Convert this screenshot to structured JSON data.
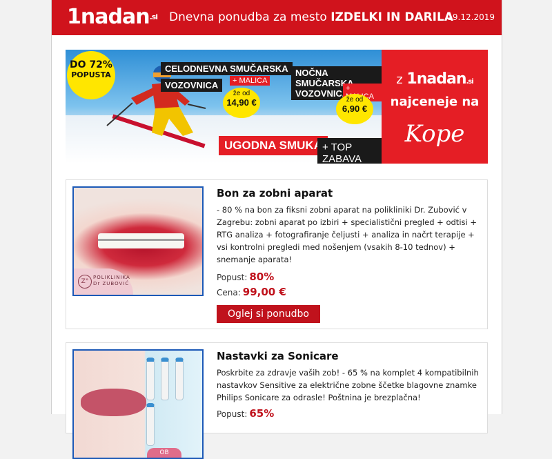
{
  "header": {
    "logo_text": "1nadan",
    "logo_suffix": ".si",
    "title_prefix": "Dnevna ponudba za mesto ",
    "title_city": "IZDELKI IN DARILA",
    "date": "19.12.2019",
    "colors": {
      "brand": "#d0131c"
    }
  },
  "banner": {
    "badge_line1": "DO 72%",
    "badge_line2": "POPUSTA",
    "tag1_line1": "CELODNEVNA SMUČARSKA",
    "tag1_line2": "VOZOVNICA",
    "tag1_extra": "+ MALICA",
    "tag1_price_from": "že od",
    "tag1_price": "14,90 €",
    "tag2_line1": "NOČNA SMUČARSKA",
    "tag2_line2": "VOZOVNICA",
    "tag2_extra": "+ MALICA",
    "tag2_price_from": "že od",
    "tag2_price": "6,90 €",
    "cta1": "UGODNA SMUKA",
    "cta2": "+ TOP ZABAVA",
    "right_z": "z",
    "right_logo": "1nadan",
    "right_logo_suffix": ".si",
    "right_text": "najceneje na",
    "right_brand": "Kope"
  },
  "offers": [
    {
      "title": "Bon za zobni aparat",
      "description": "- 80 % na bon za fiksni zobni aparat na polikliniki Dr. Zubović v Zagrebu: zobni aparat po izbiri + specialistični pregled + odtisi + RTG analiza + fotografiranje čeljusti + analiza in načrt terapije + vsi kontrolni pregledi med nošenjem (vsakih 8-10 tednov) + snemanje aparata!",
      "discount_label": "Popust:",
      "discount": "80%",
      "price_label": "Cena:",
      "price": "99,00 €",
      "button": "Oglej si ponudbo",
      "stamp_mark": "Z°",
      "stamp_line1": "POLIKLINIKA",
      "stamp_line2": "Dr ZUBOVIĆ"
    },
    {
      "title": "Nastavki za Sonicare",
      "description": "Poskrbite za zdravje vaših zob! - 65 % na komplet 4 kompatibilnih nastavkov Sensitive za električne zobne ščetke blagovne znamke Philips Sonicare za odrasle! Poštnina je brezplačna!",
      "discount_label": "Popust:",
      "discount": "65%",
      "badge": "OB NAKUPU"
    }
  ]
}
